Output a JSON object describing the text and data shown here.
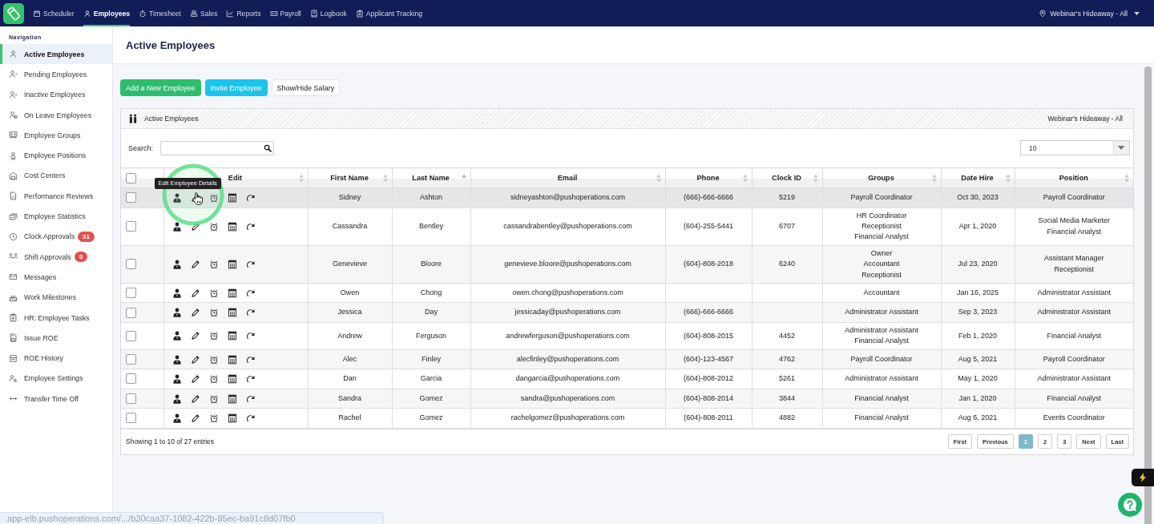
{
  "top_nav": {
    "items": [
      {
        "label": "Scheduler",
        "selected": false
      },
      {
        "label": "Employees",
        "selected": true
      },
      {
        "label": "Timesheet",
        "selected": false
      },
      {
        "label": "Sales",
        "selected": false
      },
      {
        "label": "Reports",
        "selected": false
      },
      {
        "label": "Payroll",
        "selected": false
      },
      {
        "label": "Logbook",
        "selected": false
      },
      {
        "label": "Applicant Tracking",
        "selected": false
      }
    ],
    "location": "Webinar's Hideaway - All"
  },
  "sidebar": {
    "heading": "Navigation",
    "items": [
      {
        "label": "Active Employees",
        "selected": true
      },
      {
        "label": "Pending Employees",
        "selected": false
      },
      {
        "label": "Inactive Employees",
        "selected": false
      },
      {
        "label": "On Leave Employees",
        "selected": false
      },
      {
        "label": "Employee Groups",
        "selected": false
      },
      {
        "label": "Employee Positions",
        "selected": false
      },
      {
        "label": "Cost Centers",
        "selected": false
      },
      {
        "label": "Performance Reviews",
        "selected": false
      },
      {
        "label": "Employee Statistics",
        "selected": false
      },
      {
        "label": "Clock Approvals",
        "selected": false,
        "badge": "31"
      },
      {
        "label": "Shift Approvals",
        "selected": false,
        "badge": "0"
      },
      {
        "label": "Messages",
        "selected": false
      },
      {
        "label": "Work Milestones",
        "selected": false
      },
      {
        "label": "HR: Employee Tasks",
        "selected": false
      },
      {
        "label": "Issue ROE",
        "selected": false
      },
      {
        "label": "ROE History",
        "selected": false
      },
      {
        "label": "Employee Settings",
        "selected": false
      },
      {
        "label": "Transfer Time Off",
        "selected": false
      }
    ]
  },
  "page": {
    "title": "Active Employees"
  },
  "actions": [
    {
      "label": "Add a New Employee",
      "kind": "primary"
    },
    {
      "label": "Invite Employee",
      "kind": "info"
    },
    {
      "label": "Show/Hide Salary",
      "kind": "default"
    }
  ],
  "panel": {
    "title": "Active Employees",
    "location": "Webinar's Hideaway - All"
  },
  "search": {
    "label": "Search:"
  },
  "page_size": {
    "value": "10"
  },
  "table": {
    "select_all_checked": false,
    "tooltip": "Edit Employee Details",
    "columns": [
      {
        "label": "Edit",
        "sorted": false
      },
      {
        "label": "First Name",
        "sorted": false
      },
      {
        "label": "Last Name",
        "sorted": true
      },
      {
        "label": "Email",
        "sorted": false
      },
      {
        "label": "Phone",
        "sorted": false
      },
      {
        "label": "Clock ID",
        "sorted": false
      },
      {
        "label": "Groups",
        "sorted": false
      },
      {
        "label": "Date Hire",
        "sorted": false
      },
      {
        "label": "Position",
        "sorted": false
      }
    ],
    "rows": [
      {
        "checked": false,
        "hovered": true,
        "first_name": "Sidney",
        "last_name": "Ashton",
        "email": "sidneyashton@pushoperations.com",
        "phone": "(666)-666-6666",
        "clock_id": "5219",
        "groups": [
          "Payroll Coordinator"
        ],
        "date_hire": "Oct 30, 2023",
        "positions": [
          "Payroll Coordinator"
        ]
      },
      {
        "checked": false,
        "hovered": false,
        "first_name": "Cassandra",
        "last_name": "Bentley",
        "email": "cassandrabentley@pushoperations.com",
        "phone": "(604)-255-5441",
        "clock_id": "6707",
        "groups": [
          "HR Coordinator",
          "Receptionist",
          "Financial Analyst"
        ],
        "date_hire": "Apr 1, 2020",
        "positions": [
          "Social Media Marketer",
          "Financial Analyst"
        ]
      },
      {
        "checked": false,
        "hovered": false,
        "first_name": "Genevieve",
        "last_name": "Bloore",
        "email": "genevieve.bloore@pushoperations.com",
        "phone": "(604)-808-2018",
        "clock_id": "6240",
        "groups": [
          "Owner",
          "Accountant",
          "Receptionist"
        ],
        "date_hire": "Jul 23, 2020",
        "positions": [
          "Assistant Manager",
          "Receptionist"
        ]
      },
      {
        "checked": false,
        "hovered": false,
        "first_name": "Owen",
        "last_name": "Chong",
        "email": "owen.chong@pushoperations.com",
        "groups": [
          "Accountant"
        ],
        "date_hire": "Jan 16, 2025",
        "positions": [
          "Administrator Assistant"
        ]
      },
      {
        "checked": false,
        "hovered": false,
        "first_name": "Jessica",
        "last_name": "Day",
        "email": "jessicaday@pushoperations.com",
        "phone": "(666)-666-6666",
        "groups": [
          "Administrator Assistant"
        ],
        "date_hire": "Sep 3, 2023",
        "positions": [
          "Administrator Assistant"
        ]
      },
      {
        "checked": false,
        "hovered": false,
        "first_name": "Andrew",
        "last_name": "Ferguson",
        "email": "andrewferguson@pushoperations.com",
        "phone": "(604)-808-2015",
        "clock_id": "4452",
        "groups": [
          "Administrator Assistant",
          "Financial Analyst"
        ],
        "date_hire": "Feb 1, 2020",
        "positions": [
          "Financial Analyst"
        ]
      },
      {
        "checked": false,
        "hovered": false,
        "first_name": "Alec",
        "last_name": "Finley",
        "email": "alecfinley@pushoperations.com",
        "phone": "(604)-123-4567",
        "clock_id": "4762",
        "groups": [
          "Payroll Coordinator"
        ],
        "date_hire": "Aug 5, 2021",
        "positions": [
          "Payroll Coordinator"
        ]
      },
      {
        "checked": false,
        "hovered": false,
        "first_name": "Dan",
        "last_name": "Garcia",
        "email": "dangarcia@pushoperations.com",
        "phone": "(604)-808-2012",
        "clock_id": "5261",
        "groups": [
          "Administrator Assistant"
        ],
        "date_hire": "May 1, 2020",
        "positions": [
          "Administrator Assistant"
        ]
      },
      {
        "checked": false,
        "hovered": false,
        "first_name": "Sandra",
        "last_name": "Gomez",
        "email": "sandra@pushoperations.com",
        "phone": "(604)-808-2014",
        "clock_id": "3844",
        "groups": [
          "Financial Analyst"
        ],
        "date_hire": "Jan 1, 2020",
        "positions": [
          "Financial Analyst"
        ]
      },
      {
        "checked": false,
        "hovered": false,
        "first_name": "Rachel",
        "last_name": "Gomez",
        "email": "rachelgomez@pushoperations.com",
        "phone": "(604)-808-2011",
        "clock_id": "4882",
        "groups": [
          "Financial Analyst"
        ],
        "date_hire": "Aug 6, 2021",
        "positions": [
          "Events Coordinator"
        ]
      }
    ]
  },
  "footer": {
    "info": "Showing 1 to 10 of 27 entries",
    "pager": [
      {
        "label": "First",
        "selected": false
      },
      {
        "label": "Previous",
        "selected": false
      },
      {
        "label": "1",
        "selected": true
      },
      {
        "label": "2",
        "selected": false
      },
      {
        "label": "3",
        "selected": false
      },
      {
        "label": "Next",
        "selected": false
      },
      {
        "label": "Last",
        "selected": false
      }
    ]
  },
  "link_preview": ".app-elb.pushoperations.com/.../b30caa37-1082-422b-85ec-ba91c8d07fb0"
}
